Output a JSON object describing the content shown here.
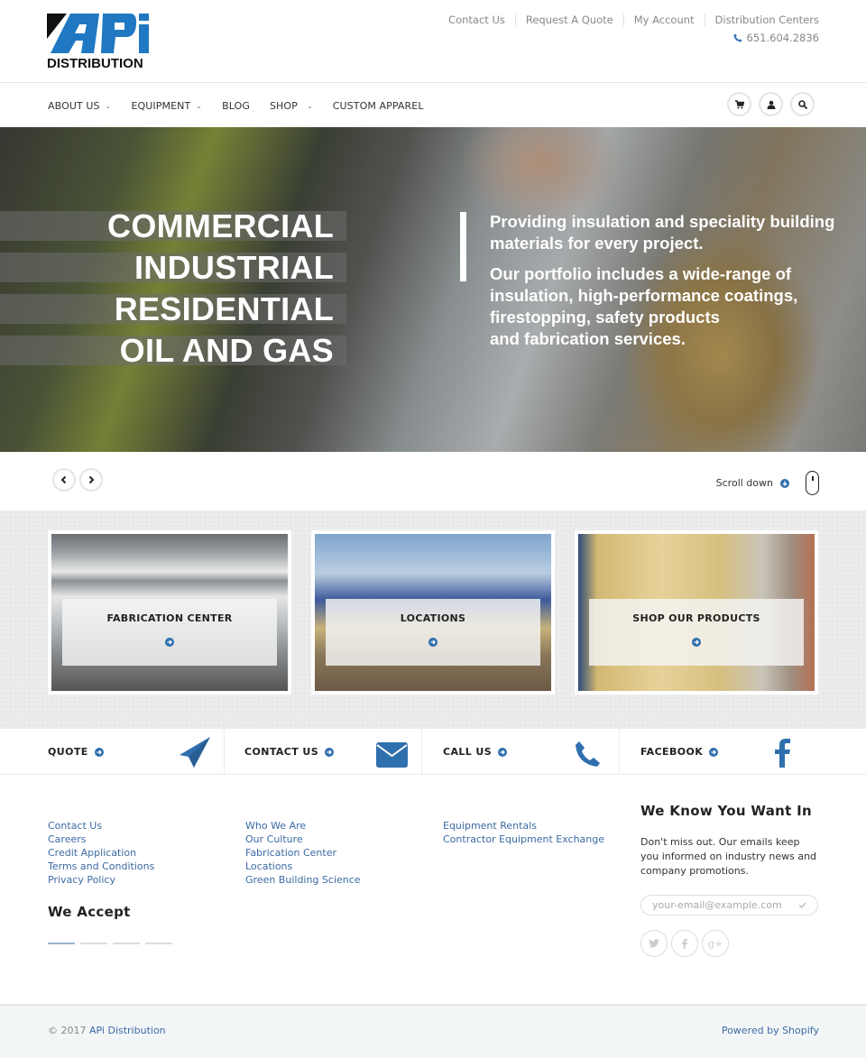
{
  "brand": {
    "name": "APi",
    "sub": "DISTRIBUTION",
    "colors": {
      "primary": "#1f78c1",
      "dark": "#111111",
      "link": "#3b6aa3",
      "icon_blue": "#2f6fad"
    }
  },
  "top_links": [
    "Contact Us",
    "Request A Quote",
    "My Account",
    "Distribution Centers"
  ],
  "phone": "651.604.2836",
  "nav": {
    "items": [
      {
        "label": "ABOUT US",
        "has_dropdown": true
      },
      {
        "label": "EQUIPMENT",
        "has_dropdown": true
      },
      {
        "label": "BLOG",
        "has_dropdown": false
      },
      {
        "label": "SHOP",
        "has_dropdown": true
      },
      {
        "label": "CUSTOM APPAREL",
        "has_dropdown": false
      }
    ],
    "icons": [
      "cart-icon",
      "user-icon",
      "search-icon"
    ]
  },
  "hero": {
    "words": [
      "COMMERCIAL",
      "INDUSTRIAL",
      "RESIDENTIAL",
      "OIL AND GAS"
    ],
    "para1": "Providing insulation and speciality building materials for every project.",
    "para2_lines": [
      "Our portfolio includes a wide-range of",
      "insulation, high-performance coatings,",
      "firestopping, safety products",
      "and fabrication services."
    ]
  },
  "slider": {
    "prev": "previous",
    "next": "next",
    "scroll_label": "Scroll down"
  },
  "tiles": [
    {
      "title": "FABRICATION CENTER"
    },
    {
      "title": "LOCATIONS"
    },
    {
      "title": "SHOP OUR PRODUCTS"
    }
  ],
  "cta": [
    {
      "label": "QUOTE",
      "icon": "paper-plane-icon"
    },
    {
      "label": "CONTACT US",
      "icon": "envelope-icon"
    },
    {
      "label": "CALL US",
      "icon": "phone-icon"
    },
    {
      "label": "FACEBOOK",
      "icon": "facebook-icon"
    }
  ],
  "footer": {
    "col1": [
      "Contact Us",
      "Careers",
      "Credit Application",
      "Terms and Conditions",
      "Privacy Policy"
    ],
    "col2": [
      "Who We Are",
      "Our Culture",
      "Fabrication Center",
      "Locations",
      "Green Building Science"
    ],
    "col3": [
      "Equipment Rentals",
      "Contractor Equipment Exchange"
    ],
    "we_accept": "We Accept",
    "newsletter": {
      "title": "We Know You Want In",
      "text": "Don't miss out. Our emails keep you informed on industry news and company promotions.",
      "placeholder": "your-email@example.com"
    },
    "social": [
      "twitter-icon",
      "facebook-icon",
      "google-plus-icon"
    ],
    "copyright_prefix": "© 2017",
    "copyright_brand": "APi Distribution",
    "powered": "Powered by Shopify"
  }
}
